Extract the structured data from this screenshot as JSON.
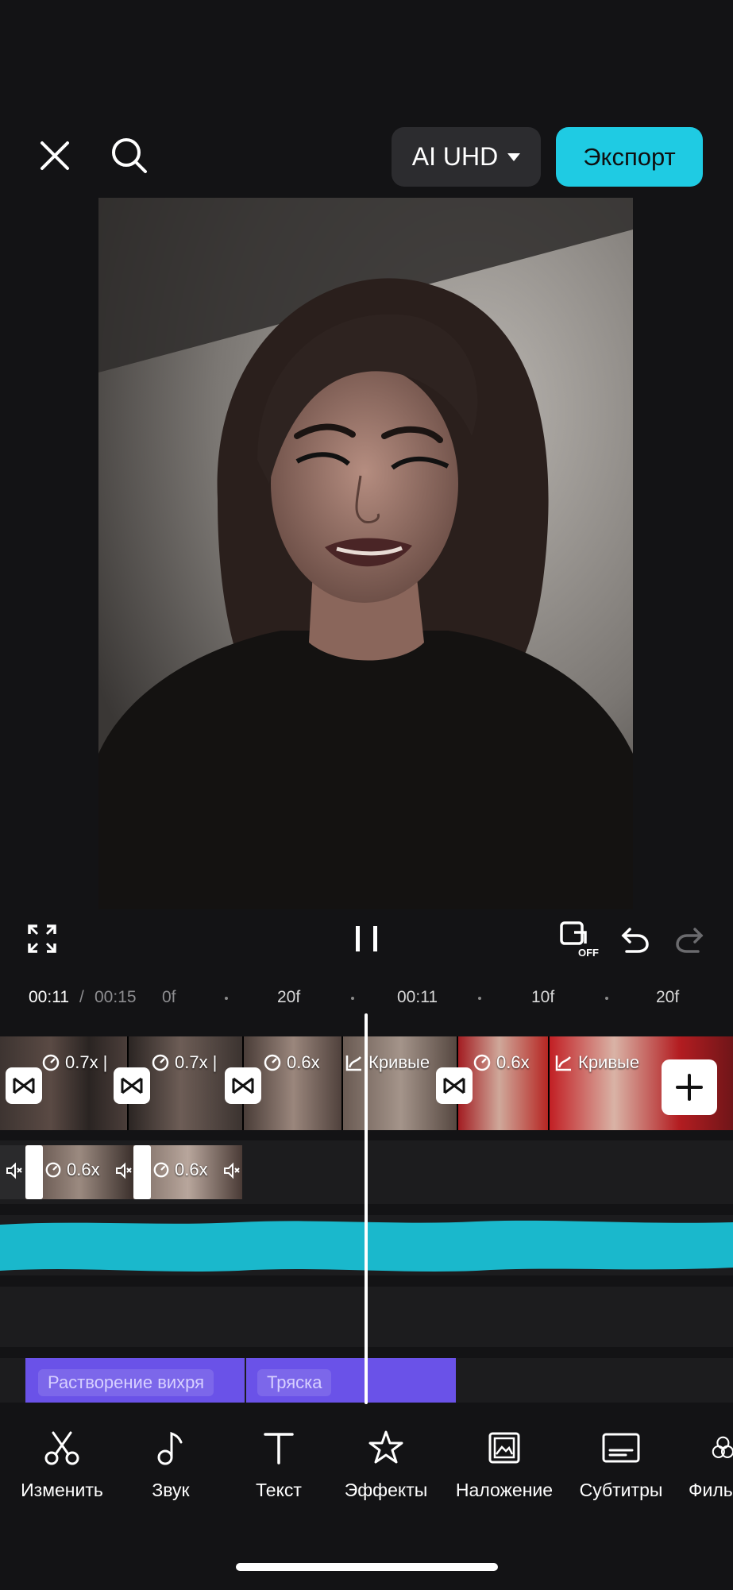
{
  "top_bar": {
    "close_icon": "close-icon",
    "search_icon": "search-icon",
    "quality_label": "AI UHD",
    "export_label": "Экспорт"
  },
  "preview": {
    "description_icon": "video-preview"
  },
  "playback": {
    "fullscreen_icon": "fullscreen-icon",
    "pause_icon": "pause-icon",
    "keyframe_icon": "keyframe-off-icon",
    "keyframe_badge": "OFF",
    "undo_icon": "undo-icon",
    "redo_icon": "redo-icon"
  },
  "timeline": {
    "current_time": "00:11",
    "separator": "/",
    "total_time": "00:15",
    "ruler_labels": [
      "0f",
      "20f",
      "00:11",
      "10f",
      "20f"
    ]
  },
  "main_track": {
    "clips": [
      {
        "speed": "0.7x",
        "prefix": "|"
      },
      {
        "speed": "0.7x",
        "prefix": "|"
      },
      {
        "speed": "0.6x",
        "prefix": ""
      },
      {
        "label": "Кривые"
      },
      {
        "speed": "0.6x",
        "prefix": ""
      },
      {
        "label": "Кривые"
      }
    ]
  },
  "overlay_track": {
    "clips": [
      {
        "speed": "0.6x"
      },
      {
        "speed": "0.6x"
      }
    ]
  },
  "audio_track": {
    "color": "#1ab8cc"
  },
  "effects_track": {
    "effects": [
      {
        "label": "Растворение вихря"
      },
      {
        "label": "Тряска"
      }
    ],
    "color": "#6a52e8"
  },
  "toolbar": {
    "items": [
      {
        "label": "Изменить",
        "icon": "scissors-icon"
      },
      {
        "label": "Звук",
        "icon": "music-note-icon"
      },
      {
        "label": "Текст",
        "icon": "text-icon"
      },
      {
        "label": "Эффекты",
        "icon": "star-effect-icon"
      },
      {
        "label": "Наложение",
        "icon": "overlay-icon"
      },
      {
        "label": "Субтитры",
        "icon": "subtitles-icon"
      },
      {
        "label": "Филь",
        "icon": "filter-icon"
      }
    ]
  },
  "colors": {
    "accent": "#1fcbe3",
    "background": "#131315"
  }
}
